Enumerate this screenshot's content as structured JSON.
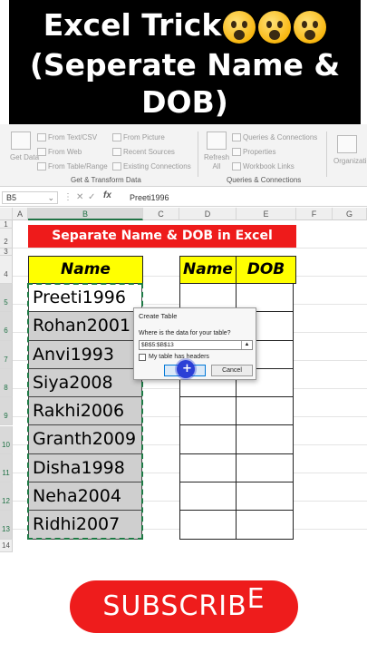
{
  "video_title": {
    "line1": "Excel Trick",
    "line2": "(Seperate Name &",
    "line3": "DOB)",
    "emojis": [
      "astonished-face-icon",
      "astonished-face-icon",
      "astonished-face-icon"
    ]
  },
  "ribbon": {
    "get_data_label": "Get Data",
    "from_text_csv": "From Text/CSV",
    "from_web": "From Web",
    "from_table_range": "From Table/Range",
    "from_picture": "From Picture",
    "recent_sources": "Recent Sources",
    "existing_connections": "Existing Connections",
    "group_get_transform": "Get & Transform Data",
    "refresh_all": "Refresh All",
    "queries_connections": "Queries & Connections",
    "properties": "Properties",
    "workbook_links": "Workbook Links",
    "group_queries": "Queries & Connections",
    "organization": "Organizati"
  },
  "formula_bar": {
    "name_box": "B5",
    "fx": "fx",
    "value": "Preeti1996"
  },
  "columns": [
    "A",
    "B",
    "C",
    "D",
    "E",
    "F",
    "G"
  ],
  "rows": [
    "1",
    "2",
    "3",
    "4",
    "5",
    "6",
    "7",
    "8",
    "9",
    "10",
    "11",
    "12",
    "13",
    "14"
  ],
  "sheet": {
    "banner": "Separate Name & DOB in Excel",
    "name_header": "Name",
    "d_header": "Name",
    "e_header": "DOB",
    "names": [
      "Preeti1996",
      "Rohan2001",
      "Anvi1993",
      "Siya2008",
      "Rakhi2006",
      "Granth2009",
      "Disha1998",
      "Neha2004",
      "Ridhi2007"
    ]
  },
  "dialog": {
    "title": "Create Table",
    "question": "Where is the data for your table?",
    "range": "$B$5:$B$13",
    "checkbox_label": "My table has headers",
    "ok": "OK",
    "cancel": "Cancel"
  },
  "subscribe": {
    "main": "SUBSCRIB",
    "last": "E"
  }
}
